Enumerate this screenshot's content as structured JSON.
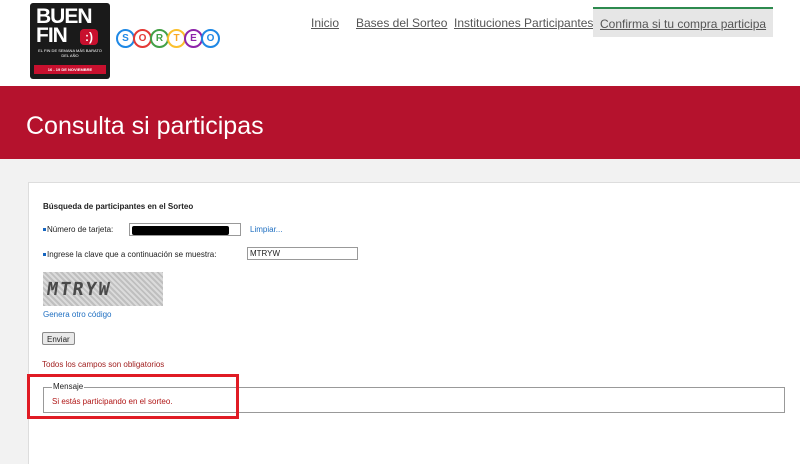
{
  "logo": {
    "line1": "BUEN",
    "line2": "FIN",
    "smile": ":)",
    "tagline": "EL FIN DE SEMANA MÁS BARATO DEL AÑO",
    "dates": "16 - 19 DE NOVIEMBRE",
    "sorteo_letters": [
      "S",
      "O",
      "R",
      "T",
      "E",
      "O"
    ],
    "sorteo_colors": [
      "#1e88e5",
      "#e53935",
      "#43a047",
      "#fbc02d",
      "#8e24aa",
      "#1e88e5"
    ]
  },
  "nav": {
    "items": [
      {
        "label": "Inicio"
      },
      {
        "label": "Bases del Sorteo"
      },
      {
        "label": "Instituciones Participantes"
      },
      {
        "label": "Confirma si tu compra participa",
        "active": true
      }
    ]
  },
  "banner": {
    "title": "Consulta si participas"
  },
  "form": {
    "heading": "Búsqueda de participantes en el Sorteo",
    "card_label": "Número de tarjeta:",
    "card_value": "",
    "clear_link": "Limpiar...",
    "captcha_label": "Ingrese la clave que a continuación se muestra:",
    "captcha_value": "MTRYW",
    "captcha_text": "MTRYW",
    "regen_link": "Genera otro código",
    "submit_label": "Enviar",
    "required_note": "Todos los campos son obligatorios"
  },
  "message": {
    "legend": "Mensaje",
    "text": "Si estás participando en el sorteo."
  },
  "colors": {
    "brand_red": "#b5122d",
    "nav_active_border": "#2d8a4e",
    "highlight": "#e01b24"
  }
}
